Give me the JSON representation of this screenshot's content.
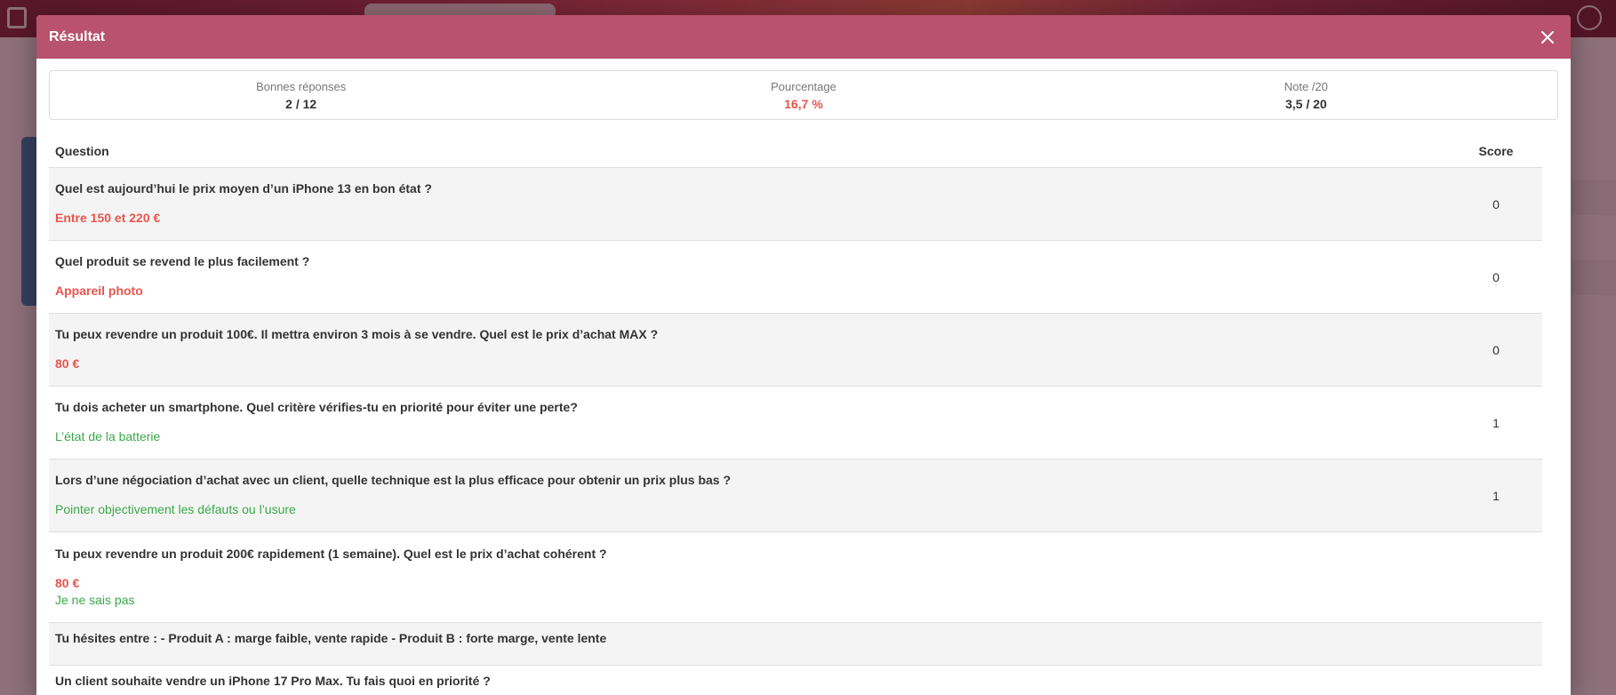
{
  "modal": {
    "title": "Résultat"
  },
  "summary": {
    "correct_label": "Bonnes réponses",
    "correct_value": "2 / 12",
    "percent_label": "Pourcentage",
    "percent_value": "16,7 %",
    "grade_label": "Note /20",
    "grade_value": "3,5 / 20"
  },
  "table": {
    "col_question": "Question",
    "col_score": "Score",
    "rows": [
      {
        "question": "Quel est aujourd’hui le prix moyen d’un iPhone 13 en bon état ?",
        "answers": [
          {
            "text": "Entre 150 et 220 €",
            "status": "wrong"
          }
        ],
        "score": "0"
      },
      {
        "question": "Quel produit se revend le plus facilement ?",
        "answers": [
          {
            "text": "Appareil photo",
            "status": "wrong"
          }
        ],
        "score": "0"
      },
      {
        "question": "Tu peux revendre un produit 100€. Il mettra environ 3 mois à se vendre. Quel est le prix d’achat MAX ?",
        "answers": [
          {
            "text": "80 €",
            "status": "wrong"
          }
        ],
        "score": "0"
      },
      {
        "question": "Tu dois acheter un smartphone. Quel critère vérifies-tu en priorité pour éviter une perte?",
        "answers": [
          {
            "text": "L’état de la batterie",
            "status": "right"
          }
        ],
        "score": "1"
      },
      {
        "question": "Lors d’une négociation d’achat avec un client, quelle technique est la plus efficace pour obtenir un prix plus bas ?",
        "answers": [
          {
            "text": "Pointer objectivement les défauts ou l’usure",
            "status": "right"
          }
        ],
        "score": "1"
      },
      {
        "question": "Tu peux revendre un produit 200€ rapidement (1 semaine). Quel est le prix d’achat cohérent ?",
        "answers": [
          {
            "text": "80 €",
            "status": "wrong"
          },
          {
            "text": "Je ne sais pas",
            "status": "right"
          }
        ],
        "score": ""
      },
      {
        "question": "Tu hésites entre : - Produit A : marge faible, vente rapide - Produit B : forte marge, vente lente",
        "answers": [],
        "score": ""
      },
      {
        "question": "Un client souhaite vendre un iPhone 17 Pro Max. Tu fais quoi en priorité ?",
        "answers": [],
        "score": ""
      }
    ]
  },
  "colors": {
    "header": "#b8526e",
    "wrong": "#e8554e",
    "right": "#3aa84a"
  },
  "icons": {
    "close": "close-icon"
  }
}
